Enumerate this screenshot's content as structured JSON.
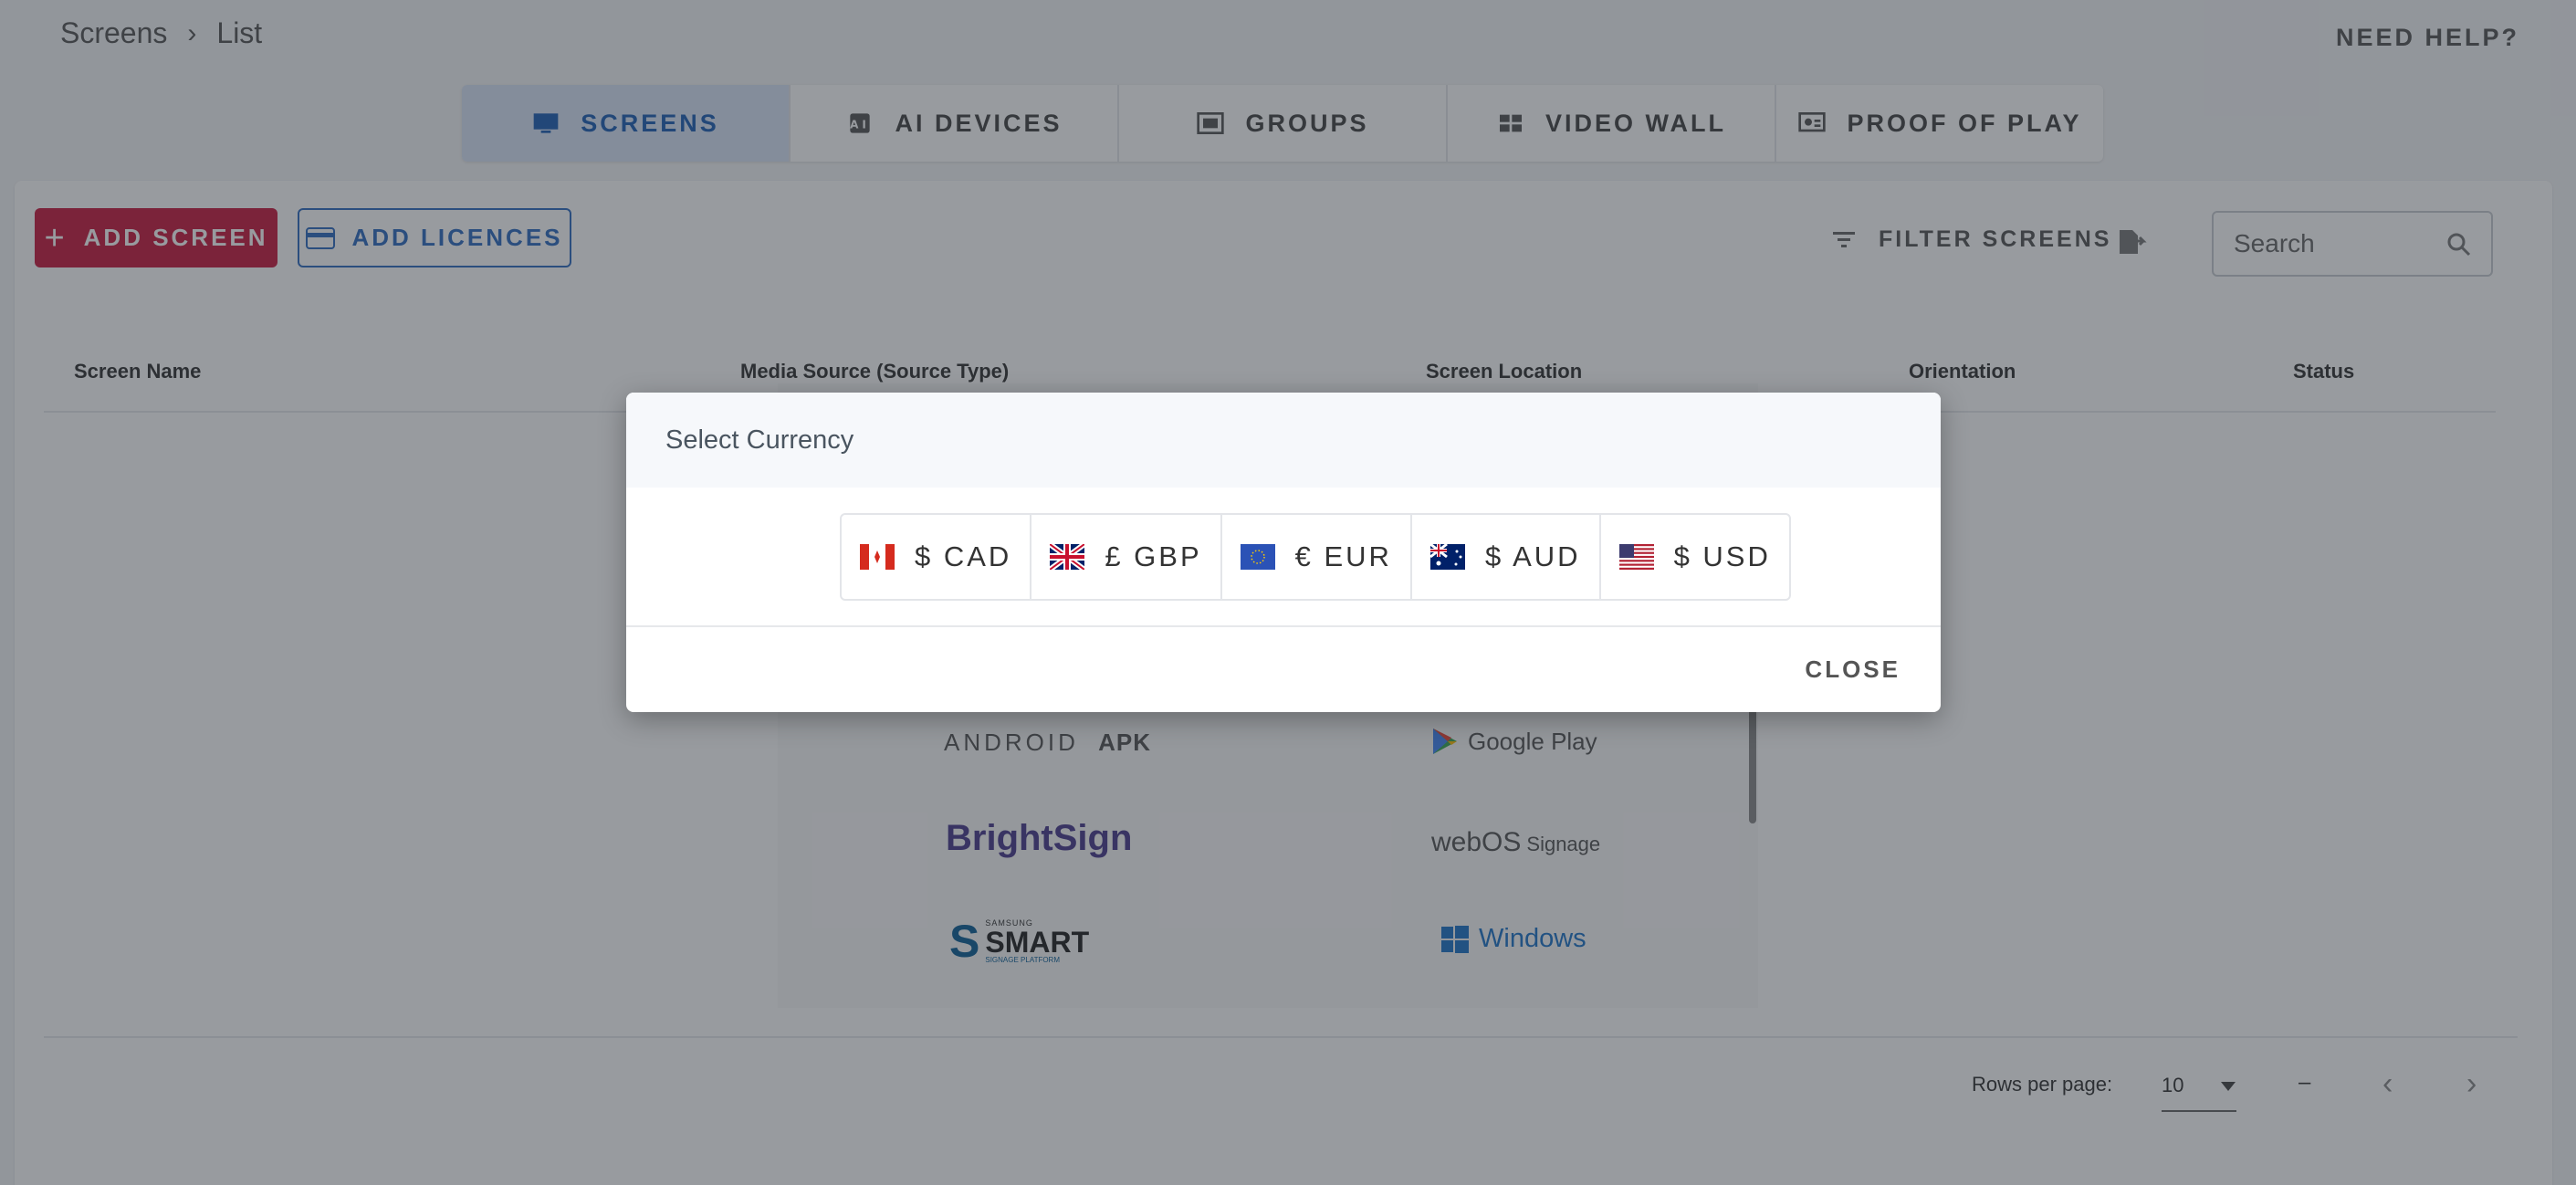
{
  "breadcrumb": {
    "root": "Screens",
    "current": "List"
  },
  "help_label": "NEED HELP?",
  "tabs": [
    {
      "label": "SCREENS",
      "icon": "monitor-icon"
    },
    {
      "label": "AI DEVICES",
      "icon": "ai-chip-icon"
    },
    {
      "label": "GROUPS",
      "icon": "groups-icon"
    },
    {
      "label": "VIDEO WALL",
      "icon": "grid-icon"
    },
    {
      "label": "PROOF OF PLAY",
      "icon": "proof-of-play-icon"
    }
  ],
  "toolbar": {
    "add_screen": "ADD SCREEN",
    "add_licences": "ADD LICENCES",
    "filter": "FILTER SCREENS",
    "search_placeholder": "Search"
  },
  "table": {
    "headers": [
      "Screen Name",
      "Media Source (Source Type)",
      "Screen Location",
      "Orientation",
      "Status"
    ]
  },
  "platforms": {
    "android": "ANDROID",
    "apk": "APK",
    "google_play": "Google Play",
    "brightsign": "BrightSign",
    "webos": "webOS",
    "signage": "Signage",
    "samsung": "SAMSUNG",
    "smart": "SMART",
    "signage_platform": "SIGNAGE PLATFORM",
    "windows": "Windows"
  },
  "pagination": {
    "rows_label": "Rows per page:",
    "rows_value": "10",
    "range": "–"
  },
  "modal": {
    "title": "Select Currency",
    "currencies": [
      {
        "label": "$ CAD",
        "flag": "canada-flag-icon"
      },
      {
        "label": "£ GBP",
        "flag": "uk-flag-icon"
      },
      {
        "label": "€ EUR",
        "flag": "eu-flag-icon"
      },
      {
        "label": "$ AUD",
        "flag": "australia-flag-icon"
      },
      {
        "label": "$ USD",
        "flag": "usa-flag-icon"
      }
    ],
    "close": "CLOSE"
  },
  "colors": {
    "primary": "#c8193f",
    "accent": "#2e6bc0",
    "active_tab_bg": "#d8e4f7"
  }
}
